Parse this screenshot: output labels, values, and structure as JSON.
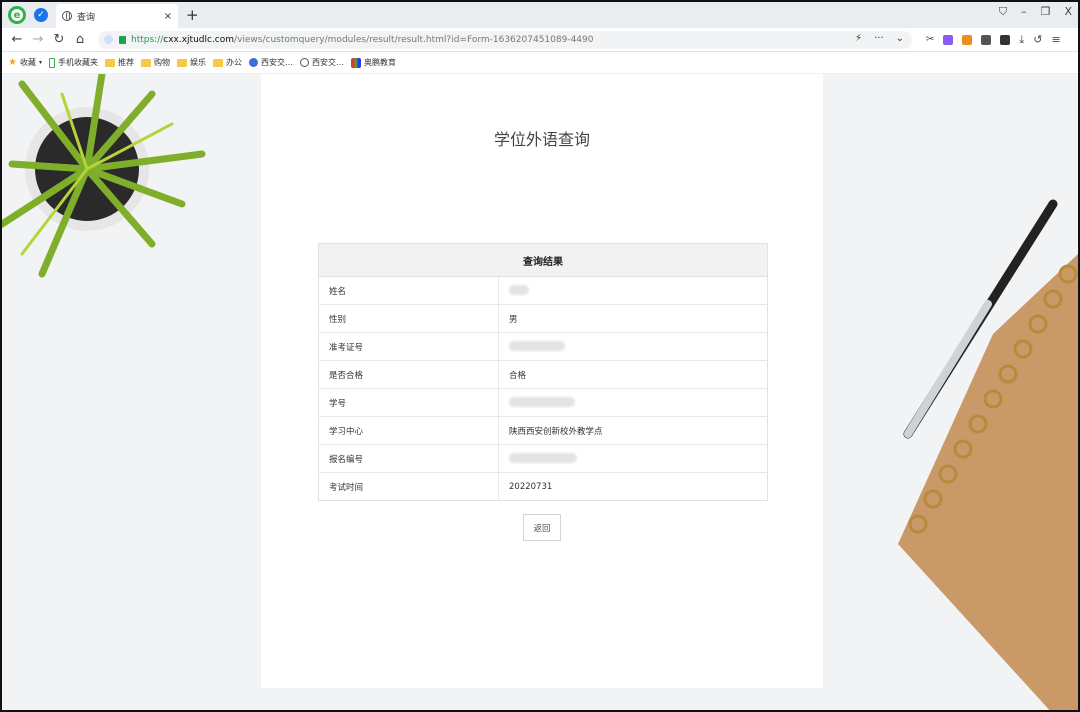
{
  "browser": {
    "tab_title": "查询",
    "tab_close": "×",
    "new_tab": "+",
    "url_scheme": "https://",
    "url_host": "cxx.xjtudlc.com",
    "url_rest": "/views/customquery/modules/result/result.html?id=Form-1636207451089-4490",
    "window_controls": [
      "⛉",
      "–",
      "❐",
      "X"
    ],
    "bookmarks": [
      {
        "label": "收藏",
        "icon": "star-icon"
      },
      {
        "label": "手机收藏夹",
        "icon": "phone-icon"
      },
      {
        "label": "推荐",
        "icon": "folder-icon"
      },
      {
        "label": "购物",
        "icon": "folder-icon"
      },
      {
        "label": "娱乐",
        "icon": "folder-icon"
      },
      {
        "label": "办公",
        "icon": "folder-icon"
      },
      {
        "label": "西安交…",
        "icon": "site-icon"
      },
      {
        "label": "西安交…",
        "icon": "globe-icon"
      },
      {
        "label": "奥鹏教育",
        "icon": "multicolor-icon"
      }
    ]
  },
  "page": {
    "title": "学位外语查询",
    "table_header": "查询结果",
    "rows": [
      {
        "key": "姓名",
        "value": "",
        "masked": true,
        "mask_width": 20
      },
      {
        "key": "性别",
        "value": "男",
        "masked": false
      },
      {
        "key": "准考证号",
        "value": "",
        "masked": true,
        "mask_width": 56
      },
      {
        "key": "是否合格",
        "value": "合格",
        "masked": false
      },
      {
        "key": "学号",
        "value": "",
        "masked": true,
        "mask_width": 66
      },
      {
        "key": "学习中心",
        "value": "陕西西安创新校外教学点",
        "masked": false
      },
      {
        "key": "报名编号",
        "value": "",
        "masked": true,
        "mask_width": 68
      },
      {
        "key": "考试时间",
        "value": "20220731",
        "masked": false
      }
    ],
    "back_button": "返回"
  },
  "colors": {
    "url_green": "#1aa34a",
    "header_bg": "#f2f2f2",
    "page_bg": "#f2f3f5"
  }
}
